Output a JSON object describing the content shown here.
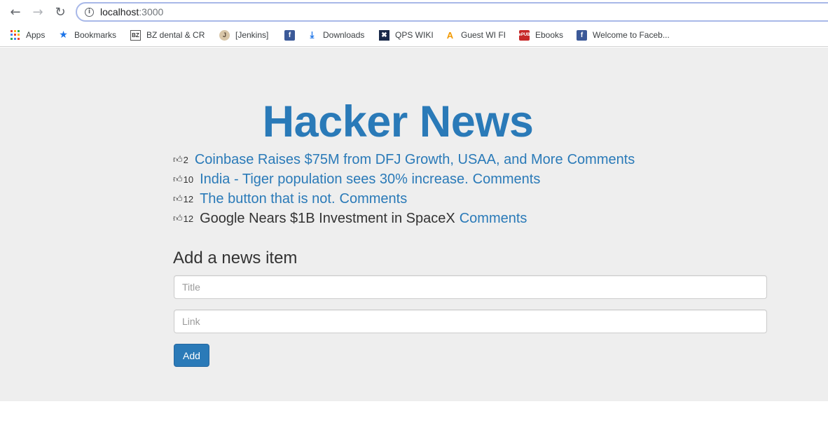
{
  "browser": {
    "url_host": "localhost",
    "url_port": ":3000",
    "bookmarks": [
      {
        "label": "Apps",
        "icon": "apps-grid-icon"
      },
      {
        "label": "Bookmarks",
        "icon": "star-icon"
      },
      {
        "label": "BZ dental & CR",
        "icon": "bz-icon"
      },
      {
        "label": "[Jenkins]",
        "icon": "jenkins-icon"
      },
      {
        "label": "",
        "icon": "facebook-icon"
      },
      {
        "label": "Downloads",
        "icon": "download-icon"
      },
      {
        "label": "QPS WIKI",
        "icon": "wiki-icon"
      },
      {
        "label": "Guest WI FI",
        "icon": "wifi-icon"
      },
      {
        "label": "Ebooks",
        "icon": "epub-icon"
      },
      {
        "label": "Welcome to Faceb...",
        "icon": "facebook-icon"
      }
    ]
  },
  "page": {
    "title": "Hacker News",
    "news": [
      {
        "votes": "2",
        "title": "Coinbase Raises $75M from DFJ Growth, USAA, and More",
        "linked": true,
        "comments": "Comments"
      },
      {
        "votes": "10",
        "title": "India - Tiger population sees 30% increase.",
        "linked": true,
        "comments": "Comments"
      },
      {
        "votes": "12",
        "title": "The button that is not.",
        "linked": true,
        "comments": "Comments"
      },
      {
        "votes": "12",
        "title": "Google Nears $1B Investment in SpaceX",
        "linked": false,
        "comments": "Comments"
      }
    ],
    "form": {
      "heading": "Add a news item",
      "title_placeholder": "Title",
      "link_placeholder": "Link",
      "submit_label": "Add"
    },
    "colors": {
      "accent": "#2a7ab8",
      "background": "#eeeeee"
    }
  }
}
